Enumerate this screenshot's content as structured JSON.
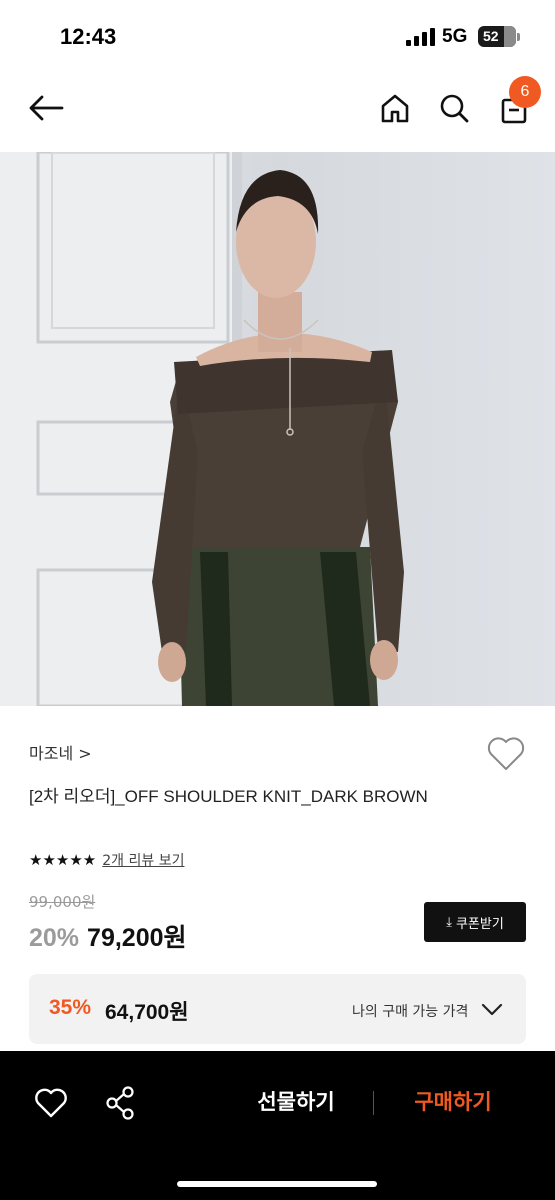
{
  "status": {
    "time": "12:43",
    "network": "5G",
    "battery": "52"
  },
  "nav": {
    "back_icon": "arrow-left-icon",
    "home_icon": "home-icon",
    "search_icon": "search-icon",
    "cart_icon": "shopping-bag-icon",
    "cart_count": "6"
  },
  "product": {
    "brand": "마조네 >",
    "title": "[2차 리오더]_OFF SHOULDER KNIT_DARK BROWN",
    "stars": "★★★★★",
    "review_link": "2개 리뷰 보기",
    "original_price": "99,000원",
    "discount_pct": "20%",
    "sale_price": "79,200원",
    "coupon_label": "쿠폰받기",
    "image_description_icon": "product-photo"
  },
  "my_price": {
    "pct": "35%",
    "amount": "64,700원",
    "label": "나의 구매 가능 가격"
  },
  "bottom": {
    "gift_label": "선물하기",
    "buy_label": "구매하기"
  },
  "colors": {
    "accent": "#f05a22",
    "dark": "#111111",
    "bar": "#000000"
  }
}
